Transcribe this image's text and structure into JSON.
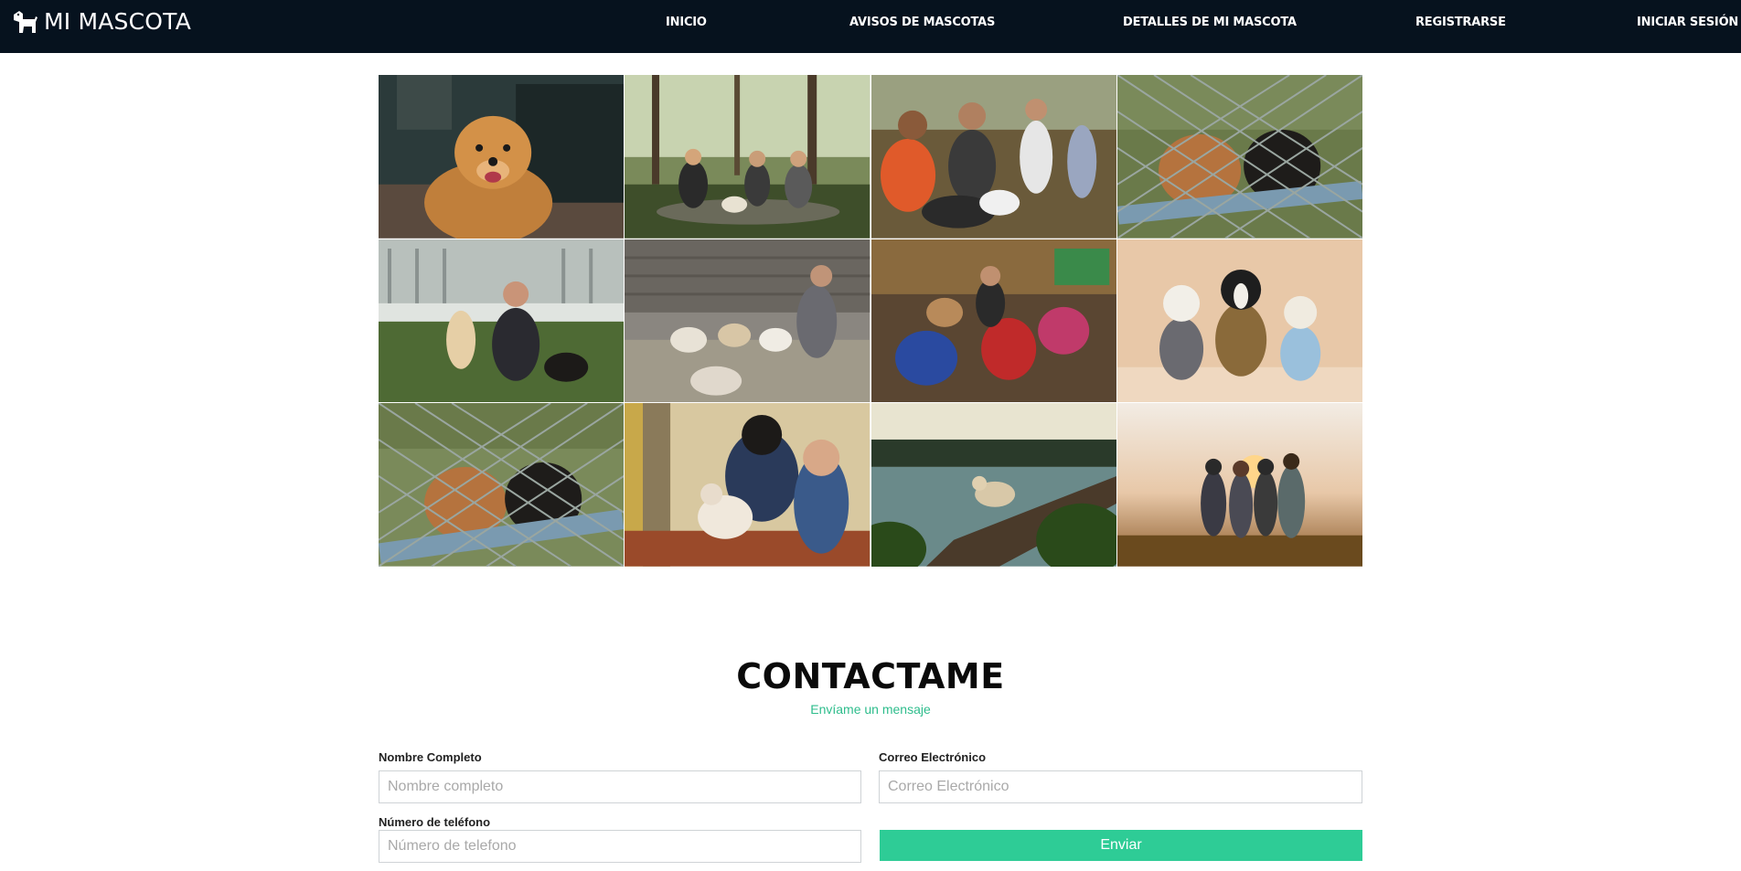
{
  "navbar": {
    "brand": "MI MASCOTA",
    "brand_icon": "dog-icon",
    "links": [
      "INICIO",
      "AVISOS DE MASCOTAS",
      "DETALLES DE MI MASCOTA",
      "REGISTRARSE",
      "INICIAR SESIÓN"
    ],
    "background": "#06121e"
  },
  "gallery": {
    "photos": [
      "golden-retriever-photo",
      "picnic-with-dogs-photo",
      "volunteers-with-dogs-photo",
      "puppies-behind-fence-photo",
      "woman-with-puppies-photo",
      "man-feeding-shelter-dogs-photo",
      "shelter-dogs-in-sweaters-photo",
      "three-dogs-studio-photo",
      "puppies-at-fence-photo",
      "family-with-dog-photo",
      "dog-on-lake-dock-photo",
      "friends-at-sunset-photo"
    ]
  },
  "contact": {
    "title": "CONTACTAME",
    "subtitle": "Envíame un mensaje",
    "name_label": "Nombre Completo",
    "name_placeholder": "Nombre completo",
    "email_label": "Correo Electrónico",
    "email_placeholder": "Correo Electrónico",
    "phone_label": "Número de teléfono",
    "phone_placeholder": "Número de telefono",
    "submit_label": "Enviar",
    "accent_color": "#2ecc96"
  }
}
